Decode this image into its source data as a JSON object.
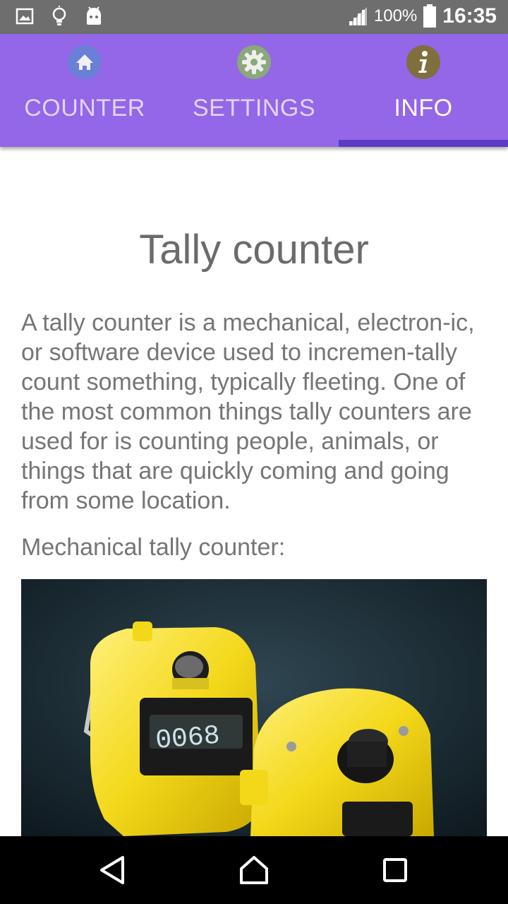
{
  "status_bar": {
    "icons": [
      "image-icon",
      "lightbulb-icon",
      "android-icon",
      "signal-icon",
      "battery-icon"
    ],
    "battery": "100%",
    "time": "16:35"
  },
  "tabs": [
    {
      "label": "COUNTER",
      "icon": "home-icon",
      "active": false
    },
    {
      "label": "SETTINGS",
      "icon": "gear-icon",
      "active": false
    },
    {
      "label": "INFO",
      "icon": "info-icon",
      "active": true
    }
  ],
  "content": {
    "title": "Tally counter",
    "paragraph": "A tally counter is a mechanical, electron-ic, or software device used to incremen-tally count something, typically fleeting. One of the most common things tally counters are used for is counting people, animals, or things that are quickly coming and going from some location.",
    "subtitle": "Mechanical tally counter:",
    "photo_counter_reading": "0068"
  },
  "nav_bar": {
    "icons": [
      "back-icon",
      "home-nav-icon",
      "recents-icon"
    ]
  },
  "colors": {
    "app_bar": "#9466e8",
    "indicator": "#5b3cc4",
    "status_bar": "#6e6e6e",
    "text": "#757575"
  }
}
